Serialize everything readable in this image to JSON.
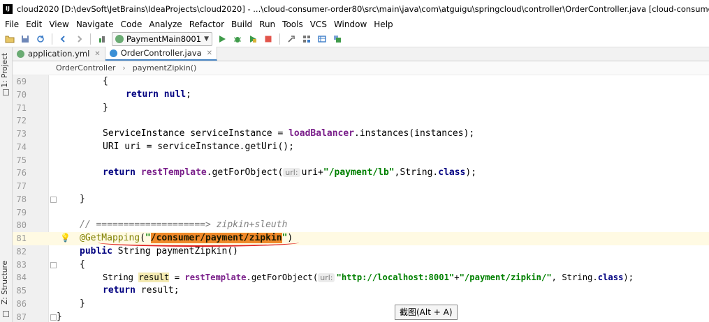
{
  "window": {
    "app_icon": "IJ",
    "title": "cloud2020 [D:\\devSoft\\JetBrains\\IdeaProjects\\cloud2020] - ...\\cloud-consumer-order80\\src\\main\\java\\com\\atguigu\\springcloud\\controller\\OrderController.java [cloud-consumer-order80] - IntelliJ IDEA"
  },
  "menu": [
    "File",
    "Edit",
    "View",
    "Navigate",
    "Code",
    "Analyze",
    "Refactor",
    "Build",
    "Run",
    "Tools",
    "VCS",
    "Window",
    "Help"
  ],
  "toolbar": {
    "run_config": "PaymentMain8001",
    "icons": [
      "open-icon",
      "save-icon",
      "sync-icon",
      "back-icon",
      "forward-icon",
      "build-icon",
      "run-icon",
      "debug-icon",
      "coverage-icon",
      "stop-icon",
      "project-structure-icon",
      "settings-icon",
      "sdk-icon",
      "vcs-icon"
    ]
  },
  "side": {
    "project_label": "1: Project",
    "structure_label": "Z: Structure"
  },
  "tabs": [
    {
      "label": "application.yml",
      "icon_color": "#6aab73",
      "active": false
    },
    {
      "label": "OrderController.java",
      "icon_color": "#3a8fd6",
      "active": true
    }
  ],
  "breadcrumb": [
    "OrderController",
    "paymentZipkin()"
  ],
  "editor": {
    "line_numbers": [
      "69",
      "70",
      "71",
      "72",
      "73",
      "74",
      "75",
      "76",
      "77",
      "78",
      "79",
      "80",
      "81",
      "82",
      "83",
      "84",
      "85",
      "86",
      "87"
    ],
    "code": {
      "l69": "{",
      "l70_kw": "return",
      "l70_val": "null",
      "l71": "}",
      "l73_a": "ServiceInstance serviceInstance = ",
      "l73_m": "loadBalancer",
      "l73_b": ".instances(instances);",
      "l74": "URI uri = serviceInstance.getUri();",
      "l76_kw": "return",
      "l76_m": "restTemplate",
      "l76_a": ".getForObject(",
      "l76_hint": "url:",
      "l76_b": "uri+",
      "l76_str": "\"/payment/lb\"",
      "l76_c": ",String.",
      "l76_kw2": "class",
      "l76_d": ");",
      "l78": "}",
      "l80": "// ====================> zipkin+sleuth",
      "l81_ann": "@GetMapping",
      "l81_a": "(",
      "l81_q1": "\"",
      "l81_str": "/consumer/payment/zipkin",
      "l81_q2": "\"",
      "l81_b": ")",
      "l82_kw": "public",
      "l82_a": " String paymentZipkin()",
      "l83": "{",
      "l84_a": "String ",
      "l84_var": "result",
      "l84_b": " = ",
      "l84_m": "restTemplate",
      "l84_c": ".getForObject(",
      "l84_hint": "url:",
      "l84_str1": "\"http://localhost:8001\"",
      "l84_d": "+",
      "l84_str2": "\"/payment/zipkin/\"",
      "l84_e": ", String.",
      "l84_kw": "class",
      "l84_f": ");",
      "l85_kw": "return",
      "l85_a": " result;",
      "l86": "}",
      "l87": "}"
    }
  },
  "tooltip": "截图(Alt + A)",
  "colors": {
    "keyword": "#000080",
    "string": "#008000",
    "field": "#7a1f8a",
    "annotation": "#808000",
    "highlight_string": "#f08a2a",
    "underline": "#e02020"
  }
}
